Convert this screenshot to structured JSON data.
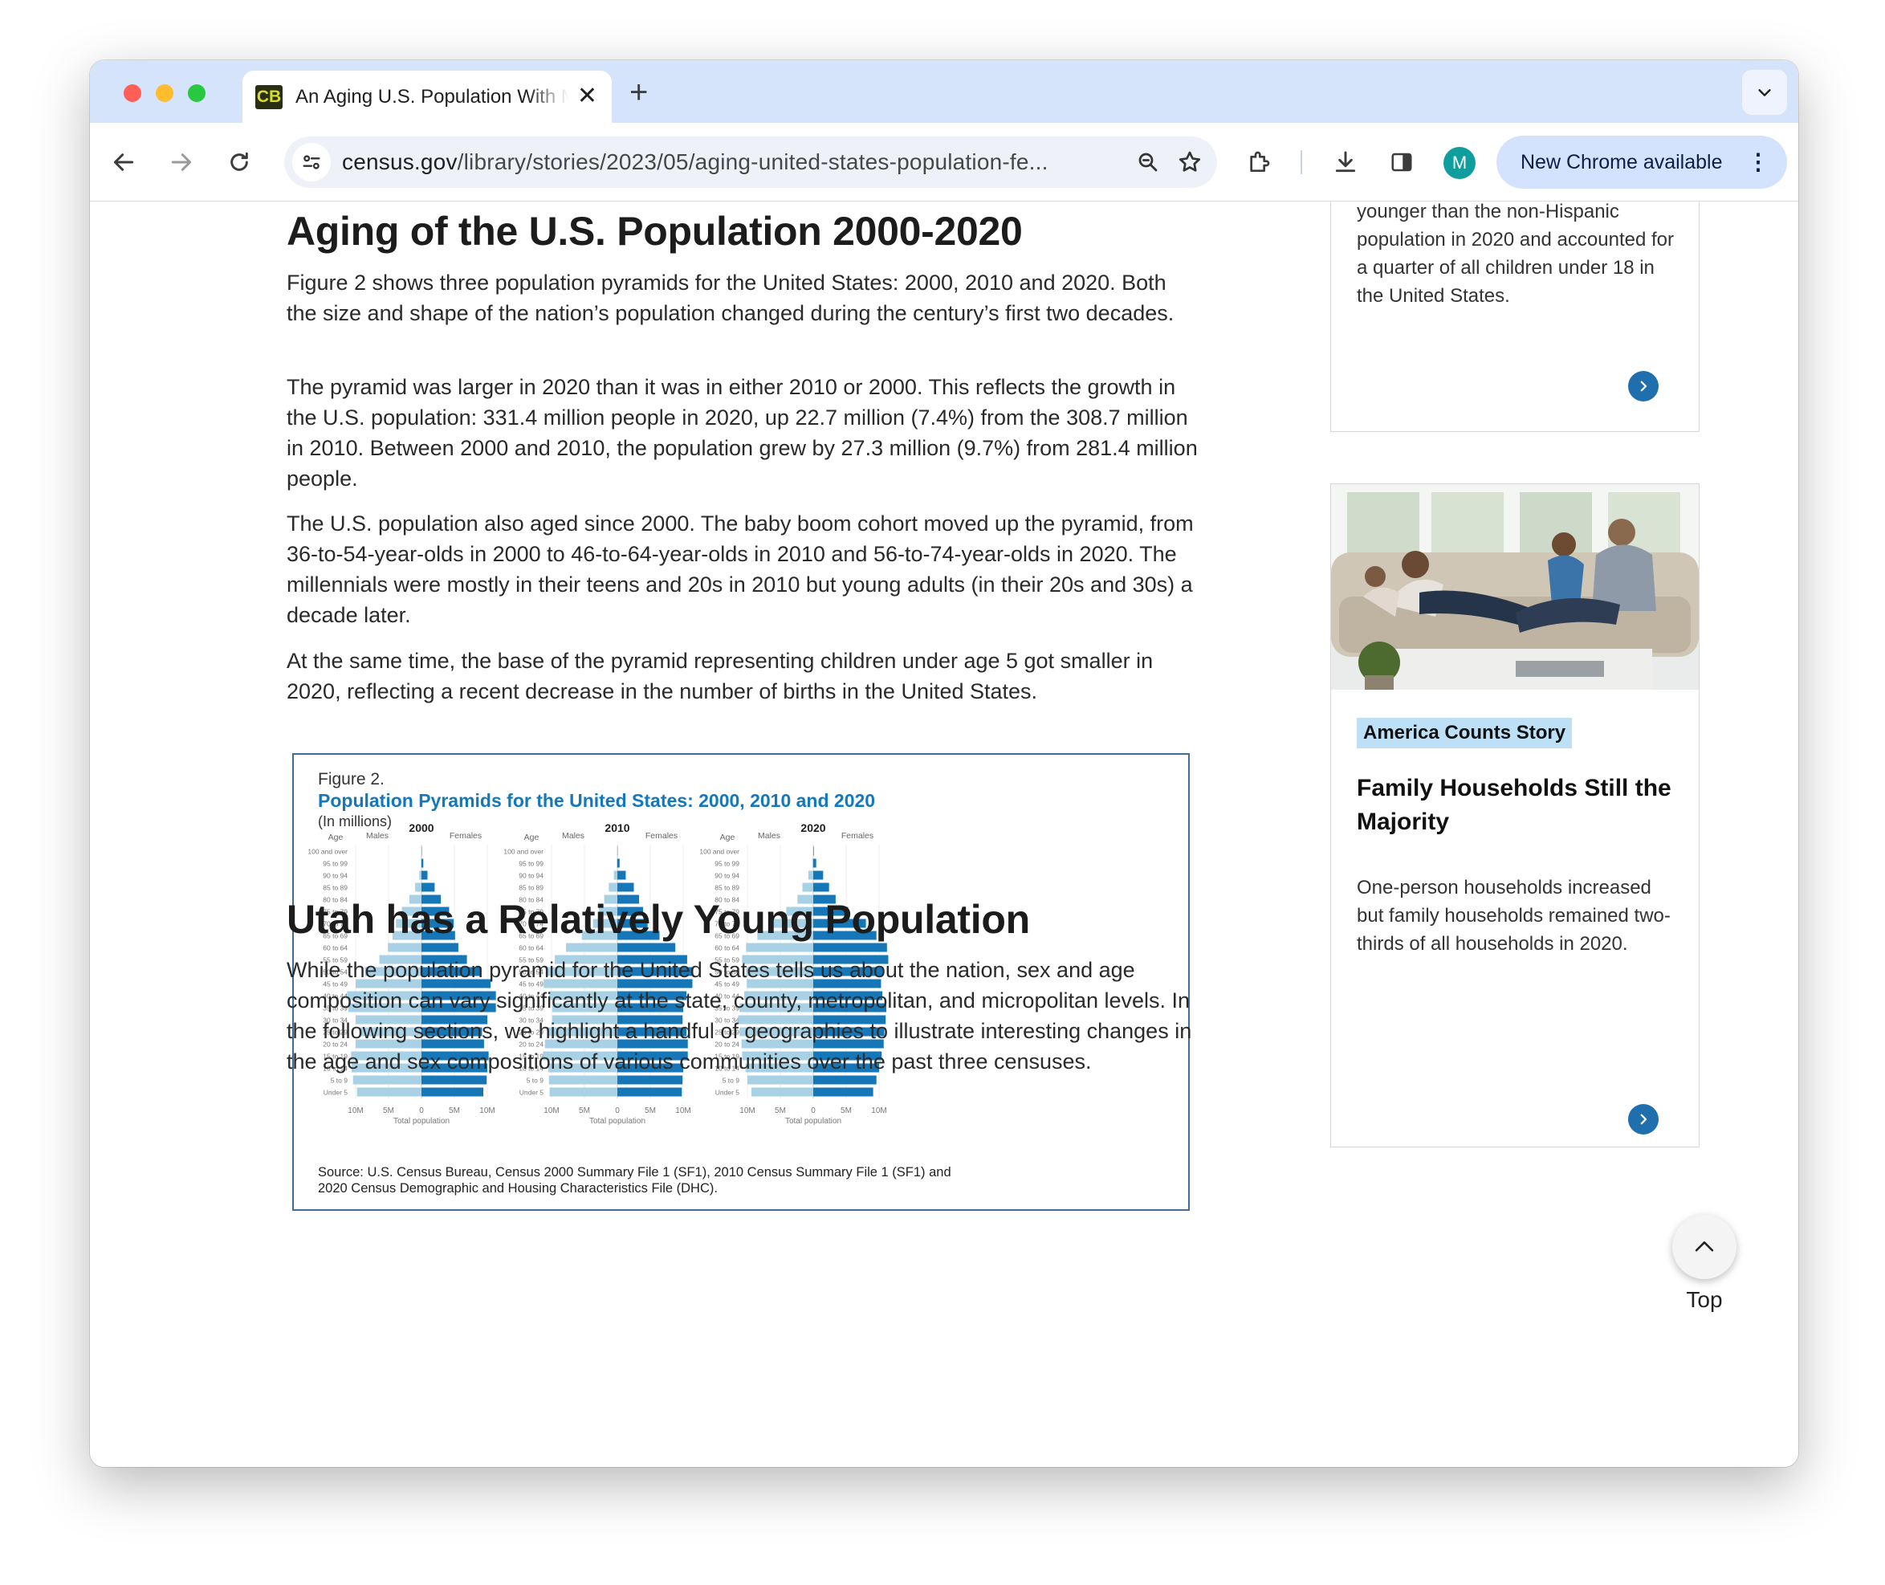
{
  "browser": {
    "tab_favicon": "CB",
    "tab_title": "An Aging U.S. Population With Many Faces",
    "url_domain": "census.gov",
    "url_path": "/library/stories/2023/05/aging-united-states-population-fe...",
    "new_chrome_label": "New Chrome available",
    "avatar_letter": "M"
  },
  "article": {
    "heading1": "Aging of the U.S. Population 2000-2020",
    "p1": "Figure 2 shows three population pyramids for the United States: 2000, 2010 and 2020. Both the size and shape of the nation’s population changed during the century’s first two decades.",
    "p2": "The pyramid was larger in 2020 than it was in either 2010 or 2000. This reflects the growth in the U.S. population: 331.4 million people in 2020, up 22.7 million (7.4%) from the 308.7 million in 2010. Between 2000 and 2010, the population grew by 27.3 million (9.7%) from 281.4 million people.",
    "p3": "The U.S. population also aged since 2000. The baby boom cohort moved up the pyramid, from 36-to-54-year-olds in 2000 to 46-to-64-year-olds in 2010 and 56-to-74-year-olds in 2020. The millennials were mostly in their teens and 20s in 2010 but young adults (in their 20s and 30s) a decade later.",
    "p4": "At the same time, the base of the pyramid representing children under age 5 got smaller in 2020, reflecting a recent decrease in the number of births in the United States.",
    "heading2": "Utah has a Relatively Young Population",
    "p5": "While the population pyramid for the United States tells us about the nation, sex and age composition can vary significantly at the state, county, metropolitan, and micropolitan levels. In the following sections, we highlight a handful of geographies to illustrate interesting changes in the age and sex compositions of various communities over the past three censuses."
  },
  "figure": {
    "label": "Figure 2.",
    "title": "Population Pyramids for the United States: 2000, 2010 and 2020",
    "subtitle": "(In millions)",
    "source_line1": "Source: U.S. Census Bureau, Census 2000 Summary File 1 (SF1), 2010 Census Summary File 1 (SF1) and",
    "source_line2": "2020 Census Demographic and Housing Characteristics File (DHC).",
    "age_header": "Age",
    "males_label": "Males",
    "females_label": "Females",
    "xlabel": "Total population",
    "ticks": [
      "10M",
      "5M",
      "0",
      "5M",
      "10M"
    ],
    "male_color": "#a9d1e6",
    "female_color": "#1577b8"
  },
  "chart_data": {
    "type": "bar",
    "orientation": "horizontal-pyramid",
    "units": "millions",
    "xlim": [
      -10,
      10
    ],
    "categories": [
      "100 and over",
      "95 to 99",
      "90 to 94",
      "85 to 89",
      "80 to 84",
      "75 to 79",
      "70 to 74",
      "65 to 69",
      "60 to 64",
      "55 to 59",
      "50 to 54",
      "45 to 49",
      "40 to 44",
      "35 to 39",
      "30 to 34",
      "25 to 29",
      "20 to 24",
      "15 to 19",
      "10 to 14",
      "5 to 9",
      "Under 5"
    ],
    "panels": [
      {
        "title": "2000",
        "males": [
          0.02,
          0.09,
          0.33,
          0.97,
          1.83,
          2.97,
          3.88,
          4.39,
          5.1,
          6.4,
          8.6,
          10.0,
          11.3,
          11.1,
          10.0,
          9.4,
          10.0,
          10.7,
          10.6,
          10.4,
          9.8
        ],
        "females": [
          0.05,
          0.28,
          0.91,
          2.0,
          2.95,
          4.2,
          4.9,
          5.1,
          5.6,
          6.9,
          9.1,
          10.5,
          11.3,
          11.3,
          10.0,
          9.2,
          9.5,
          10.2,
          10.0,
          9.9,
          9.4
        ]
      },
      {
        "title": "2010",
        "males": [
          0.01,
          0.11,
          0.53,
          1.3,
          2.0,
          2.8,
          3.7,
          5.4,
          7.8,
          9.5,
          10.9,
          11.2,
          10.4,
          9.9,
          9.9,
          10.6,
          11.0,
          11.3,
          10.5,
          10.4,
          10.3
        ],
        "females": [
          0.04,
          0.34,
          1.27,
          2.5,
          3.3,
          3.9,
          4.6,
          6.4,
          8.8,
          10.6,
          11.5,
          11.4,
          10.5,
          10.0,
          9.9,
          10.5,
          10.7,
          10.7,
          10.0,
          9.9,
          9.8
        ]
      },
      {
        "title": "2020",
        "males": [
          0.02,
          0.15,
          0.75,
          1.65,
          2.4,
          4.1,
          6.8,
          8.5,
          10.2,
          10.8,
          10.2,
          10.1,
          10.5,
          11.2,
          11.4,
          11.2,
          10.9,
          10.8,
          10.3,
          10.0,
          9.4
        ],
        "females": [
          0.08,
          0.45,
          1.5,
          2.4,
          3.4,
          5.3,
          8.0,
          9.6,
          11.2,
          11.4,
          10.5,
          10.3,
          10.5,
          11.1,
          11.0,
          10.8,
          10.7,
          10.4,
          10.0,
          9.6,
          9.1
        ]
      }
    ]
  },
  "sidebar": {
    "card1_text": "younger than the non-Hispanic population in 2020 and accounted for a quarter of all children under 18 in the United States.",
    "card2_tag": "America Counts Story",
    "card2_title": "Family Households Still the Majority",
    "card2_text": "One-person households increased but family households remained two-thirds of all households in 2020."
  },
  "back_to_top": "Top",
  "icons": [
    "back-arrow-icon",
    "forward-arrow-icon",
    "reload-icon",
    "site-info-icon",
    "zoom-icon",
    "bookmark-star-icon",
    "extensions-icon",
    "download-icon",
    "side-panel-icon",
    "kebab-menu-icon",
    "chevron-down-icon",
    "chevron-right-icon",
    "chevron-up-icon"
  ]
}
